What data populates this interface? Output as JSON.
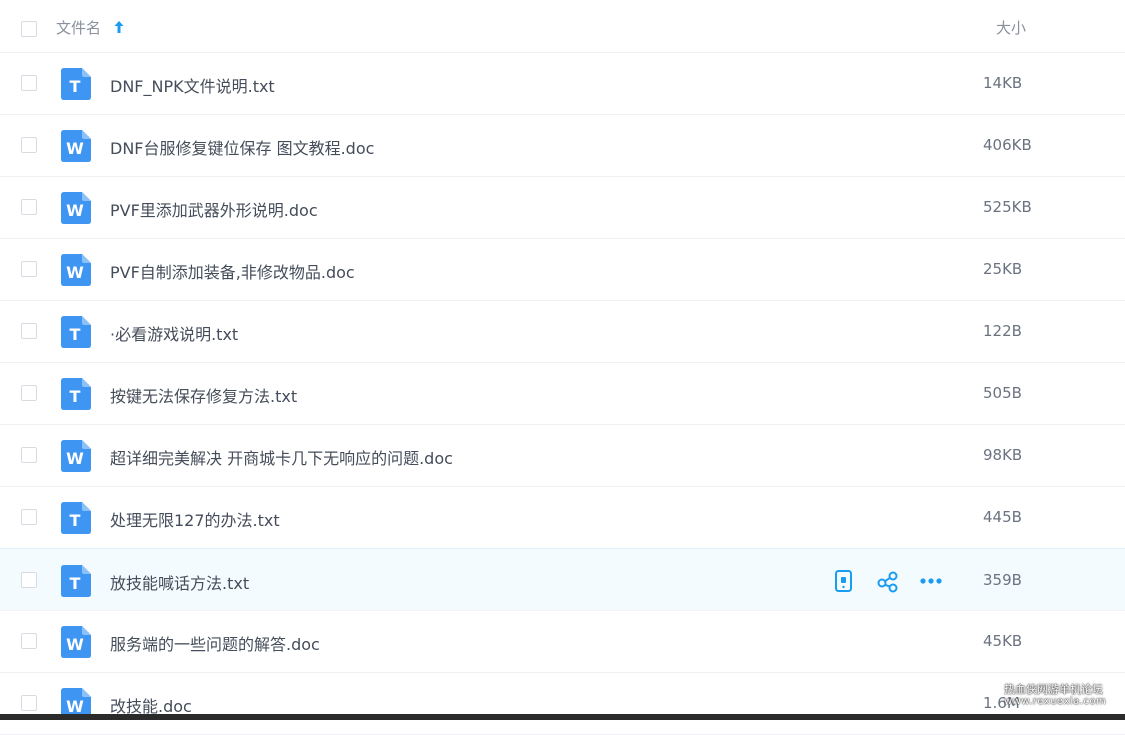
{
  "header": {
    "name_label": "文件名",
    "size_label": "大小"
  },
  "files": [
    {
      "name": "DNF_NPK文件说明.txt",
      "size": "14KB",
      "icon": "txt-file-icon",
      "icon_letter": "T"
    },
    {
      "name": "DNF台服修复键位保存 图文教程.doc",
      "size": "406KB",
      "icon": "doc-file-icon",
      "icon_letter": "W"
    },
    {
      "name": "PVF里添加武器外形说明.doc",
      "size": "525KB",
      "icon": "doc-file-icon",
      "icon_letter": "W"
    },
    {
      "name": "PVF自制添加装备,非修改物品.doc",
      "size": "25KB",
      "icon": "doc-file-icon",
      "icon_letter": "W"
    },
    {
      "name": "·必看游戏说明.txt",
      "size": "122B",
      "icon": "txt-file-icon",
      "icon_letter": "T"
    },
    {
      "name": "按键无法保存修复方法.txt",
      "size": "505B",
      "icon": "txt-file-icon",
      "icon_letter": "T"
    },
    {
      "name": "超详细完美解决 开商城卡几下无响应的问题.doc",
      "size": "98KB",
      "icon": "doc-file-icon",
      "icon_letter": "W"
    },
    {
      "name": "处理无限127的办法.txt",
      "size": "445B",
      "icon": "txt-file-icon",
      "icon_letter": "T"
    },
    {
      "name": "放技能喊话方法.txt",
      "size": "359B",
      "icon": "txt-file-icon",
      "icon_letter": "T"
    },
    {
      "name": "服务端的一些问题的解答.doc",
      "size": "45KB",
      "icon": "doc-file-icon",
      "icon_letter": "W"
    },
    {
      "name": "改技能.doc",
      "size": "1.6M",
      "icon": "doc-file-icon",
      "icon_letter": "W"
    }
  ],
  "row_actions": [
    "phone-icon",
    "share-icon",
    "more-icon"
  ],
  "watermark": {
    "line1": "热血侠网游单机论坛",
    "line2": "www.rexuexia.com"
  },
  "colors": {
    "accent": "#1a9cf0",
    "icon_blue": "#3f95f2"
  }
}
